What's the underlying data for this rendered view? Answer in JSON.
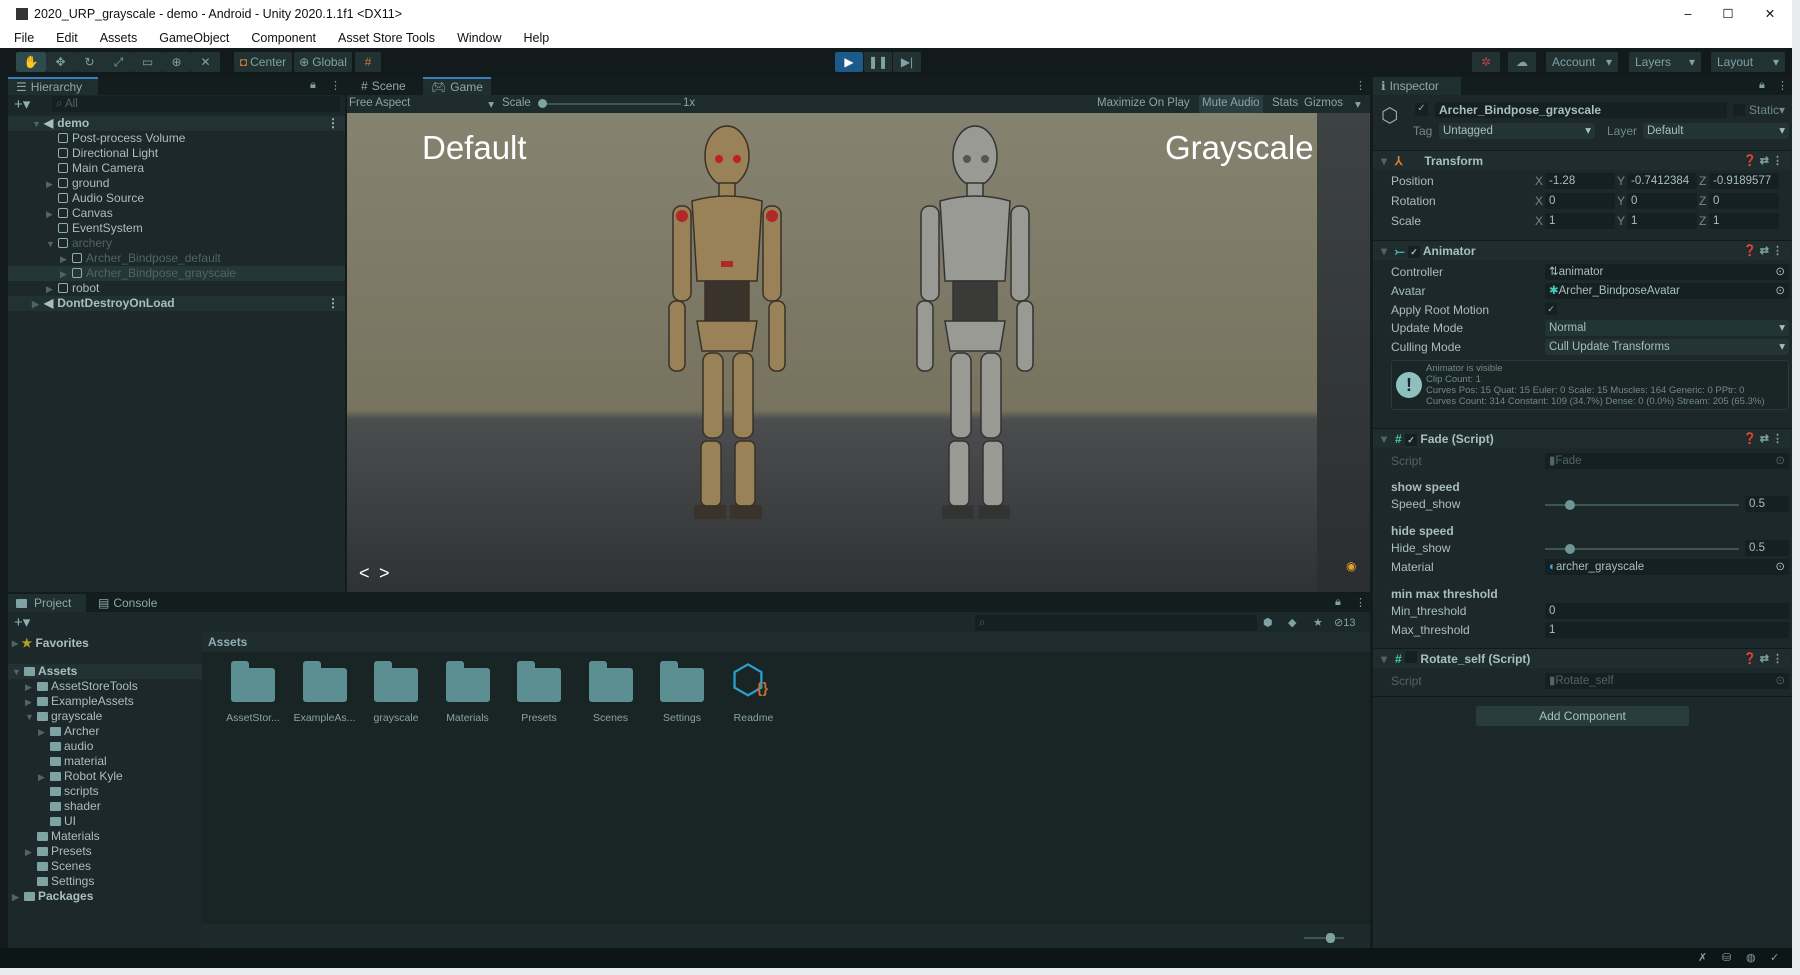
{
  "window": {
    "title": "2020_URP_grayscale - demo - Android - Unity 2020.1.1f1 <DX11>",
    "controls": [
      "–",
      "☐",
      "✕"
    ]
  },
  "menu": [
    "File",
    "Edit",
    "Assets",
    "GameObject",
    "Component",
    "Asset Store Tools",
    "Window",
    "Help"
  ],
  "toolbar": {
    "tools": [
      "hand-tool",
      "move-tool",
      "rotate-tool",
      "scale-tool",
      "rect-tool",
      "transform-tool",
      "custom-tool"
    ],
    "pivot": "Center",
    "space": "Global",
    "account": "Account",
    "layers": "Layers",
    "layout": "Layout",
    "play_active": true,
    "accent": "#1d5a8c"
  },
  "hierarchy": {
    "title": "Hierarchy",
    "search_placeholder": "All",
    "items": [
      {
        "label": "demo",
        "depth": 0,
        "kind": "scene",
        "arrow": "open"
      },
      {
        "label": "Post-process Volume",
        "depth": 1
      },
      {
        "label": "Directional Light",
        "depth": 1
      },
      {
        "label": "Main Camera",
        "depth": 1
      },
      {
        "label": "ground",
        "depth": 1,
        "arrow": "closed"
      },
      {
        "label": "Audio Source",
        "depth": 1
      },
      {
        "label": "Canvas",
        "depth": 1,
        "arrow": "closed"
      },
      {
        "label": "EventSystem",
        "depth": 1
      },
      {
        "label": "archery",
        "depth": 1,
        "arrow": "open",
        "disabled": true
      },
      {
        "label": "Archer_Bindpose_default",
        "depth": 2,
        "arrow": "closed",
        "disabled": true
      },
      {
        "label": "Archer_Bindpose_grayscale",
        "depth": 2,
        "arrow": "closed",
        "disabled": true,
        "selected": true
      },
      {
        "label": "robot",
        "depth": 1,
        "arrow": "closed"
      },
      {
        "label": "DontDestroyOnLoad",
        "depth": 0,
        "kind": "scene",
        "arrow": "closed"
      }
    ]
  },
  "game": {
    "tabs": [
      "Scene",
      "Game"
    ],
    "active_tab": "Game",
    "aspect": "Free Aspect",
    "scale_label": "Scale",
    "scale_value": "1x",
    "buttons": [
      "Maximize On Play",
      "Mute Audio",
      "Stats",
      "Gizmos"
    ],
    "label_left": "Default",
    "label_right": "Grayscale",
    "nav_prev": "<",
    "nav_next": ">"
  },
  "project": {
    "tabs": [
      "Project",
      "Console"
    ],
    "favorites": "Favorites",
    "tree": [
      {
        "label": "Assets",
        "depth": 0,
        "arrow": "open",
        "bold": true
      },
      {
        "label": "AssetStoreTools",
        "depth": 1,
        "arrow": "closed"
      },
      {
        "label": "ExampleAssets",
        "depth": 1,
        "arrow": "closed"
      },
      {
        "label": "grayscale",
        "depth": 1,
        "arrow": "open"
      },
      {
        "label": "Archer",
        "depth": 2,
        "arrow": "closed"
      },
      {
        "label": "audio",
        "depth": 2
      },
      {
        "label": "material",
        "depth": 2
      },
      {
        "label": "Robot Kyle",
        "depth": 2,
        "arrow": "closed"
      },
      {
        "label": "scripts",
        "depth": 2
      },
      {
        "label": "shader",
        "depth": 2
      },
      {
        "label": "UI",
        "depth": 2
      },
      {
        "label": "Materials",
        "depth": 1
      },
      {
        "label": "Presets",
        "depth": 1,
        "arrow": "closed"
      },
      {
        "label": "Scenes",
        "depth": 1
      },
      {
        "label": "Settings",
        "depth": 1
      },
      {
        "label": "Packages",
        "depth": 0,
        "arrow": "closed",
        "bold": true
      }
    ],
    "breadcrumb": "Assets",
    "hidden_count": "13",
    "assets": [
      "AssetStor...",
      "ExampleAs...",
      "grayscale",
      "Materials",
      "Presets",
      "Scenes",
      "Settings",
      "Readme"
    ]
  },
  "inspector": {
    "title": "Inspector",
    "object_name": "Archer_Bindpose_grayscale",
    "active": true,
    "static_label": "Static",
    "tag_label": "Tag",
    "tag": "Untagged",
    "layer_label": "Layer",
    "layer": "Default",
    "transform": {
      "title": "Transform",
      "rows": [
        {
          "label": "Position",
          "x": "-1.28",
          "y": "-0.7412384",
          "z": "-0.9189577"
        },
        {
          "label": "Rotation",
          "x": "0",
          "y": "0",
          "z": "0"
        },
        {
          "label": "Scale",
          "x": "1",
          "y": "1",
          "z": "1"
        }
      ]
    },
    "animator": {
      "title": "Animator",
      "enabled": true,
      "controller_label": "Controller",
      "controller": "animator",
      "avatar_label": "Avatar",
      "avatar": "Archer_BindposeAvatar",
      "root_motion_label": "Apply Root Motion",
      "root_motion": true,
      "update_label": "Update Mode",
      "update": "Normal",
      "culling_label": "Culling Mode",
      "culling": "Cull Update Transforms",
      "info": [
        "Animator is visible",
        "Clip Count: 1",
        "Curves Pos: 15 Quat: 15 Euler: 0 Scale: 15 Muscles: 164 Generic: 0 PPtr: 0",
        "Curves Count: 314 Constant: 109 (34.7%) Dense: 0 (0.0%) Stream: 205 (65.3%)"
      ]
    },
    "fade": {
      "title": "Fade (Script)",
      "enabled": true,
      "script_label": "Script",
      "script": "Fade",
      "show_header": "show speed",
      "speed_label": "Speed_show",
      "speed": "0.5",
      "speed_fraction": 0.13,
      "hide_header": "hide speed",
      "hide_label": "Hide_show",
      "hide": "0.5",
      "hide_fraction": 0.13,
      "material_label": "Material",
      "material": "archer_grayscale",
      "threshold_header": "min max threshold",
      "min_label": "Min_threshold",
      "min": "0",
      "max_label": "Max_threshold",
      "max": "1"
    },
    "rotate": {
      "title": "Rotate_self (Script)",
      "enabled": false,
      "script_label": "Script",
      "script": "Rotate_self"
    },
    "add_component": "Add Component"
  }
}
